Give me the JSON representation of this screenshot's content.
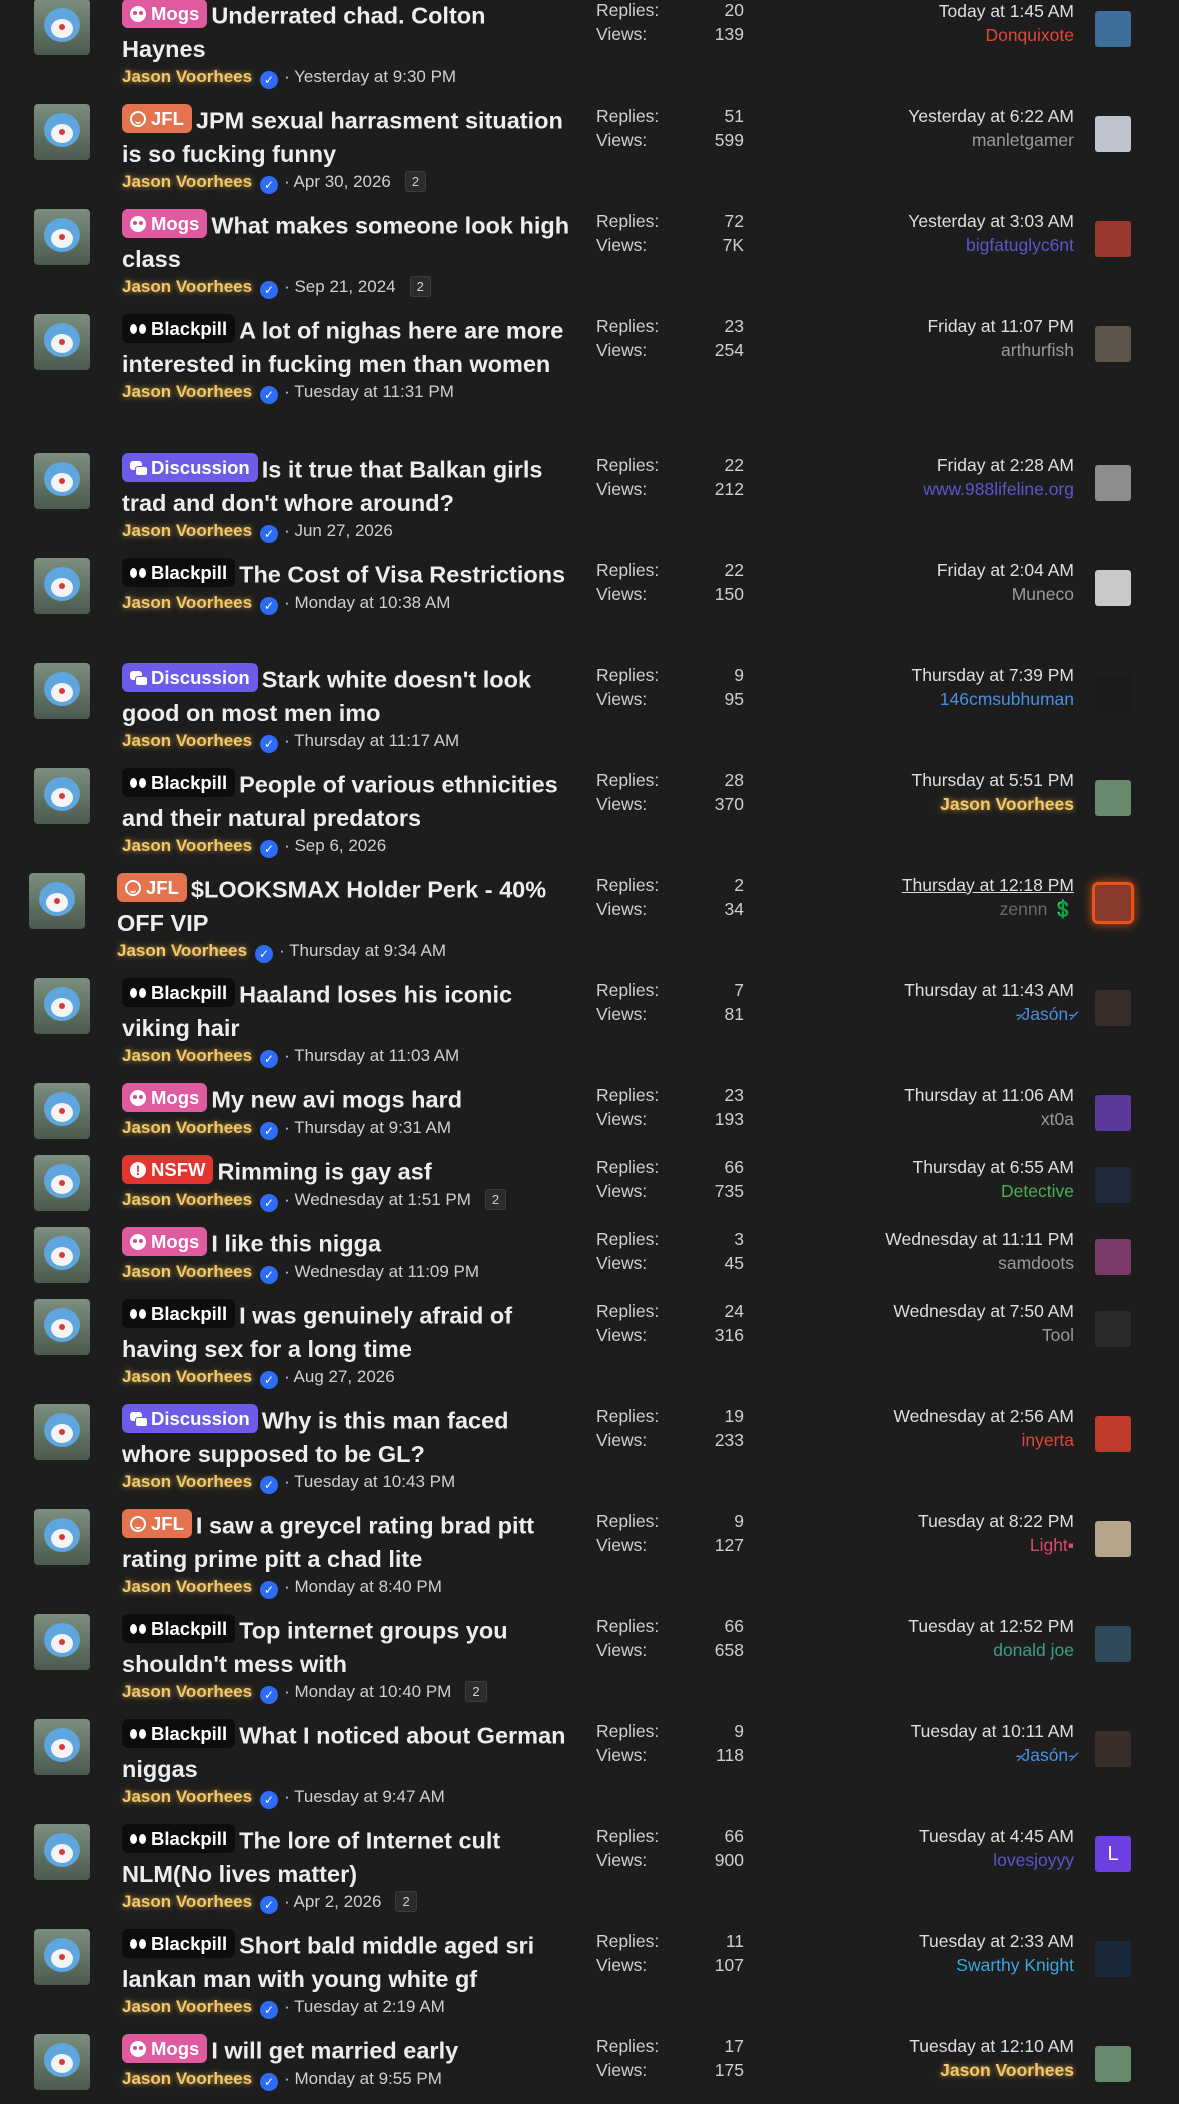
{
  "labels": {
    "replies": "Replies:",
    "views": "Views:"
  },
  "prefix_colors": {
    "Mogs": "#e05aa0",
    "JFL": "#e3744f",
    "Blackpill": "#0d0d0d",
    "Discussion": "#6c5ce7",
    "NSFW": "#e3342f"
  },
  "threads": [
    {
      "prefix": "Mogs",
      "prefix_icon": "skull-icon",
      "title": "Underrated chad. Colton Haynes",
      "author": "Jason Voorhees",
      "date": "Yesterday at 9:30 PM",
      "pages": "",
      "replies": "20",
      "views": "139",
      "last_time": "Today at 1:45 AM",
      "last_user": "Donquixote",
      "last_user_color": "#e0473a",
      "last_avatar_color": "#3e6f9a"
    },
    {
      "prefix": "JFL",
      "prefix_icon": "emoji-icon",
      "title": "JPM sexual harrasment situation is so fucking funny",
      "author": "Jason Voorhees",
      "date": "Apr 30, 2026",
      "pages": "2",
      "replies": "51",
      "views": "599",
      "last_time": "Yesterday at 6:22 AM",
      "last_user": "manletgamer",
      "last_user_color": "#9a9a9a",
      "last_avatar_color": "#bfc4cf"
    },
    {
      "prefix": "Mogs",
      "prefix_icon": "skull-icon",
      "title": "What makes someone look high class",
      "author": "Jason Voorhees",
      "date": "Sep 21, 2024",
      "pages": "2",
      "replies": "72",
      "views": "7K",
      "last_time": "Yesterday at 3:03 AM",
      "last_user": "bigfatuglyc6nt",
      "last_user_color": "#5a58c9",
      "last_avatar_color": "#9a3a2e"
    },
    {
      "prefix": "Blackpill",
      "prefix_icon": "glasses-icon",
      "title": "A lot of nighas here are more interested in fucking men than women",
      "author": "Jason Voorhees",
      "date": "Tuesday at 11:31 PM",
      "pages": "",
      "replies": "23",
      "views": "254",
      "last_time": "Friday at 11:07 PM",
      "last_user": "arthurfish",
      "last_user_color": "#9a9a9a",
      "last_avatar_color": "#5e554a"
    },
    {
      "prefix": "Discussion",
      "prefix_icon": "chat-icon",
      "title": "Is it true that Balkan girls trad and don't whore around?",
      "author": "Jason Voorhees",
      "date": "Jun 27, 2026",
      "pages": "",
      "replies": "22",
      "views": "212",
      "last_time": "Friday at 2:28 AM",
      "last_user": "www.988lifeline.org",
      "last_user_color": "#5a58c9",
      "last_avatar_color": "#8d8d8d"
    },
    {
      "prefix": "Blackpill",
      "prefix_icon": "glasses-icon",
      "title": "The Cost of Visa Restrictions",
      "author": "Jason Voorhees",
      "date": "Monday at 10:38 AM",
      "pages": "",
      "replies": "22",
      "views": "150",
      "last_time": "Friday at 2:04 AM",
      "last_user": "Muneco",
      "last_user_color": "#9a9a9a",
      "last_avatar_color": "#c9c9c9"
    },
    {
      "prefix": "Discussion",
      "prefix_icon": "chat-icon",
      "title": "Stark white doesn't look good on most men imo",
      "author": "Jason Voorhees",
      "date": "Thursday at 11:17 AM",
      "pages": "",
      "replies": "9",
      "views": "95",
      "last_time": "Thursday at 7:39 PM",
      "last_user": "146cmsubhuman",
      "last_user_color": "#4a8fe0",
      "last_avatar_color": "#1a1a1a"
    },
    {
      "prefix": "Blackpill",
      "prefix_icon": "glasses-icon",
      "title": "People of various ethnicities and their natural predators",
      "author": "Jason Voorhees",
      "date": "Sep 6, 2026",
      "pages": "",
      "replies": "28",
      "views": "370",
      "last_time": "Thursday at 5:51 PM",
      "last_user": "Jason Voorhees",
      "last_user_color": "#f3c86a",
      "last_avatar_color": "#6a8a6e"
    },
    {
      "prefix": "JFL",
      "prefix_icon": "emoji-icon",
      "title": "$LOOKSMAX Holder Perk - 40% OFF VIP",
      "author": "Jason Voorhees",
      "date": "Thursday at 9:34 AM",
      "pages": "",
      "replies": "2",
      "views": "34",
      "last_time": "Thursday at 12:18 PM",
      "last_user": "zennn 💲",
      "last_user_color": "#6b6b6b",
      "last_avatar_color": "#8a3a2a"
    },
    {
      "prefix": "Blackpill",
      "prefix_icon": "glasses-icon",
      "title": "Haaland loses his iconic viking hair",
      "author": "Jason Voorhees",
      "date": "Thursday at 11:03 AM",
      "pages": "",
      "replies": "7",
      "views": "81",
      "last_time": "Thursday at 11:43 AM",
      "last_user": "-̷Jasón-̷",
      "last_user_color": "#4a8fe0",
      "last_avatar_color": "#3a2e2a"
    },
    {
      "prefix": "Mogs",
      "prefix_icon": "skull-icon",
      "title": "My new avi mogs hard",
      "author": "Jason Voorhees",
      "date": "Thursday at 9:31 AM",
      "pages": "",
      "replies": "23",
      "views": "193",
      "last_time": "Thursday at 11:06 AM",
      "last_user": "xt0a",
      "last_user_color": "#9a9a9a",
      "last_avatar_color": "#5a3a9a"
    },
    {
      "prefix": "NSFW",
      "prefix_icon": "alert-icon",
      "title": "Rimming is gay asf",
      "author": "Jason Voorhees",
      "date": "Wednesday at 1:51 PM",
      "pages": "2",
      "replies": "66",
      "views": "735",
      "last_time": "Thursday at 6:55 AM",
      "last_user": "Detective",
      "last_user_color": "#4caf50",
      "last_avatar_color": "#1e2a3a"
    },
    {
      "prefix": "Mogs",
      "prefix_icon": "skull-icon",
      "title": "I like this nigga",
      "author": "Jason Voorhees",
      "date": "Wednesday at 11:09 PM",
      "pages": "",
      "replies": "3",
      "views": "45",
      "last_time": "Wednesday at 11:11 PM",
      "last_user": "samdoots",
      "last_user_color": "#9a9a9a",
      "last_avatar_color": "#7a3a6a"
    },
    {
      "prefix": "Blackpill",
      "prefix_icon": "glasses-icon",
      "title": "I was genuinely afraid of having sex for a long time",
      "author": "Jason Voorhees",
      "date": "Aug 27, 2026",
      "pages": "",
      "replies": "24",
      "views": "316",
      "last_time": "Wednesday at 7:50 AM",
      "last_user": "Tool",
      "last_user_color": "#9a9a9a",
      "last_avatar_color": "#2a2a2a"
    },
    {
      "prefix": "Discussion",
      "prefix_icon": "chat-icon",
      "title": "Why is this man faced whore supposed to be GL?",
      "author": "Jason Voorhees",
      "date": "Tuesday at 10:43 PM",
      "pages": "",
      "replies": "19",
      "views": "233",
      "last_time": "Wednesday at 2:56 AM",
      "last_user": "inyerta",
      "last_user_color": "#e0473a",
      "last_avatar_color": "#c0392b"
    },
    {
      "prefix": "JFL",
      "prefix_icon": "emoji-icon",
      "title": "I saw a greycel rating brad pitt rating prime pitt a chad lite",
      "author": "Jason Voorhees",
      "date": "Monday at 8:40 PM",
      "pages": "",
      "replies": "9",
      "views": "127",
      "last_time": "Tuesday at 8:22 PM",
      "last_user": "Light▪",
      "last_user_color": "#e0476a",
      "last_avatar_color": "#b5a58a"
    },
    {
      "prefix": "Blackpill",
      "prefix_icon": "glasses-icon",
      "title": "Top internet groups you shouldn't mess with",
      "author": "Jason Voorhees",
      "date": "Monday at 10:40 PM",
      "pages": "2",
      "replies": "66",
      "views": "658",
      "last_time": "Tuesday at 12:52 PM",
      "last_user": "donald joe",
      "last_user_color": "#3aa08a",
      "last_avatar_color": "#2e4a5a"
    },
    {
      "prefix": "Blackpill",
      "prefix_icon": "glasses-icon",
      "title": "What I noticed about German niggas",
      "author": "Jason Voorhees",
      "date": "Tuesday at 9:47 AM",
      "pages": "",
      "replies": "9",
      "views": "118",
      "last_time": "Tuesday at 10:11 AM",
      "last_user": "-̷Jasón-̷",
      "last_user_color": "#4a8fe0",
      "last_avatar_color": "#3a2e2a"
    },
    {
      "prefix": "Blackpill",
      "prefix_icon": "glasses-icon",
      "title": "The lore of Internet cult NLM(No lives matter)",
      "author": "Jason Voorhees",
      "date": "Apr 2, 2026",
      "pages": "2",
      "replies": "66",
      "views": "900",
      "last_time": "Tuesday at 4:45 AM",
      "last_user": "lovesjoyyy",
      "last_user_color": "#5a58c9",
      "last_avatar_color": "#6c3fe0",
      "last_avatar_letter": "L"
    },
    {
      "prefix": "Blackpill",
      "prefix_icon": "glasses-icon",
      "title": "Short bald middle aged sri lankan man with young white gf",
      "author": "Jason Voorhees",
      "date": "Tuesday at 2:19 AM",
      "pages": "",
      "replies": "11",
      "views": "107",
      "last_time": "Tuesday at 2:33 AM",
      "last_user": "Swarthy Knight",
      "last_user_color": "#3aa8e0",
      "last_avatar_color": "#1a2a3a"
    },
    {
      "prefix": "Mogs",
      "prefix_icon": "skull-icon",
      "title": "I will get married early",
      "author": "Jason Voorhees",
      "date": "Monday at 9:55 PM",
      "pages": "",
      "replies": "17",
      "views": "175",
      "last_time": "Tuesday at 12:10 AM",
      "last_user": "Jason Voorhees",
      "last_user_color": "#f3c86a",
      "last_avatar_color": "#6a8a6e"
    }
  ]
}
